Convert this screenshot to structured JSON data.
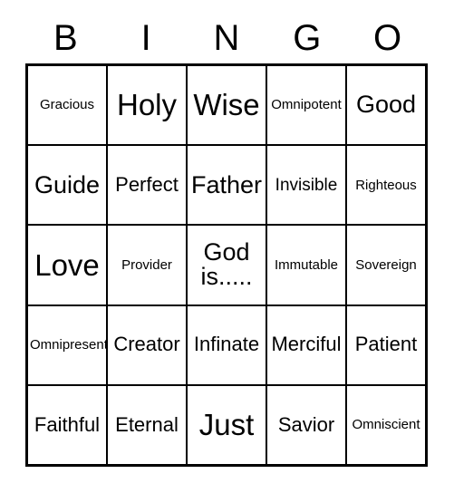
{
  "header": {
    "letters": [
      "B",
      "I",
      "N",
      "G",
      "O"
    ]
  },
  "grid": {
    "rows": [
      [
        {
          "label": "Gracious",
          "size": "xs"
        },
        {
          "label": "Holy",
          "size": "xl"
        },
        {
          "label": "Wise",
          "size": "xl"
        },
        {
          "label": "Omnipotent",
          "size": "xs"
        },
        {
          "label": "Good",
          "size": "lg"
        }
      ],
      [
        {
          "label": "Guide",
          "size": "lg"
        },
        {
          "label": "Perfect",
          "size": "md"
        },
        {
          "label": "Father",
          "size": "lg"
        },
        {
          "label": "Invisible",
          "size": "sm"
        },
        {
          "label": "Righteous",
          "size": "xs"
        }
      ],
      [
        {
          "label": "Love",
          "size": "xl"
        },
        {
          "label": "Provider",
          "size": "xs"
        },
        {
          "label": "God\nis.....",
          "size": "lg"
        },
        {
          "label": "Immutable",
          "size": "xs"
        },
        {
          "label": "Sovereign",
          "size": "xs"
        }
      ],
      [
        {
          "label": "Omnipresent",
          "size": "xs"
        },
        {
          "label": "Creator",
          "size": "md"
        },
        {
          "label": "Infinate",
          "size": "md"
        },
        {
          "label": "Merciful",
          "size": "md"
        },
        {
          "label": "Patient",
          "size": "md"
        }
      ],
      [
        {
          "label": "Faithful",
          "size": "md"
        },
        {
          "label": "Eternal",
          "size": "md"
        },
        {
          "label": "Just",
          "size": "xl"
        },
        {
          "label": "Savior",
          "size": "md"
        },
        {
          "label": "Omniscient",
          "size": "xs"
        }
      ]
    ]
  },
  "colors": {
    "ink": "#000000",
    "paper": "#ffffff"
  }
}
